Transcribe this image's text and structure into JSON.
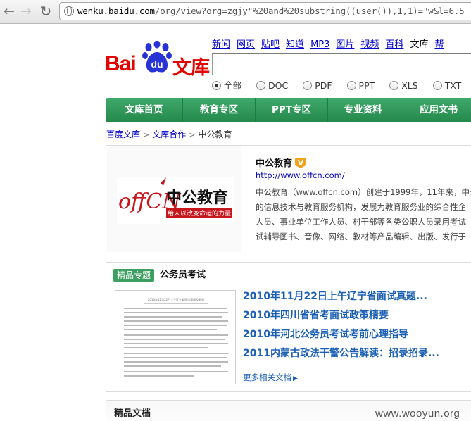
{
  "browser": {
    "url_host": "wenku.baidu.com",
    "url_rest": "/org/view?org=zgjy\"%20and%20substring((user()),1,1)=\"w&l=6.5"
  },
  "header": {
    "logo_bai": "Bai",
    "logo_du": "du",
    "logo_wenku": "文库",
    "nav": [
      "新闻",
      "网页",
      "贴吧",
      "知道",
      "MP3",
      "图片",
      "视频",
      "百科",
      "文库",
      "帮"
    ],
    "search_value": "",
    "filetypes": [
      {
        "label": "全部",
        "selected": true
      },
      {
        "label": "DOC",
        "selected": false
      },
      {
        "label": "PDF",
        "selected": false
      },
      {
        "label": "PPT",
        "selected": false
      },
      {
        "label": "XLS",
        "selected": false
      },
      {
        "label": "TXT",
        "selected": false
      }
    ]
  },
  "menu": [
    "文库首页",
    "教育专区",
    "PPT专区",
    "专业资料",
    "应用文书"
  ],
  "breadcrumb": [
    "百度文库",
    "文库合作",
    "中公教育"
  ],
  "org": {
    "name": "中公教育",
    "badge": "V",
    "url": "http://www.offcn.com/",
    "logo_text": "中公教育",
    "logo_slogan": "给人以改变命运的力量",
    "logo_letters": "offCN",
    "desc_lines": [
      "中公教育（www.offcn.com）创建于1999年，11年来，中公",
      "的信息技术与教育服务机构，发展为教育服务业的综合性企",
      "人员、事业单位工作人员、村干部等各类公职人员录用考试",
      "试辅导图书、音像、网络、教材等产品编辑、出版、发行于"
    ]
  },
  "topic": {
    "tag": "精品专题",
    "title": "公务员考试",
    "thumb_title": "2010年11月22日上午辽宁省面试真题及解析",
    "links": [
      "2010年11月22日上午辽宁省面试真题...",
      "2010年四川省省考面试政策精要",
      "2010年河北公务员考试考前心理指导",
      "2011内蒙古政法干警公告解读：招录招录..."
    ],
    "more": "更多相关文档"
  },
  "bottom": {
    "section_title": "精品文档",
    "watermark": "www.wooyun.org"
  },
  "colors": {
    "brand_red": "#e10601",
    "brand_blue": "#2732d7",
    "menu_green": "#2e9a58",
    "link_blue": "#1a5fb4"
  }
}
